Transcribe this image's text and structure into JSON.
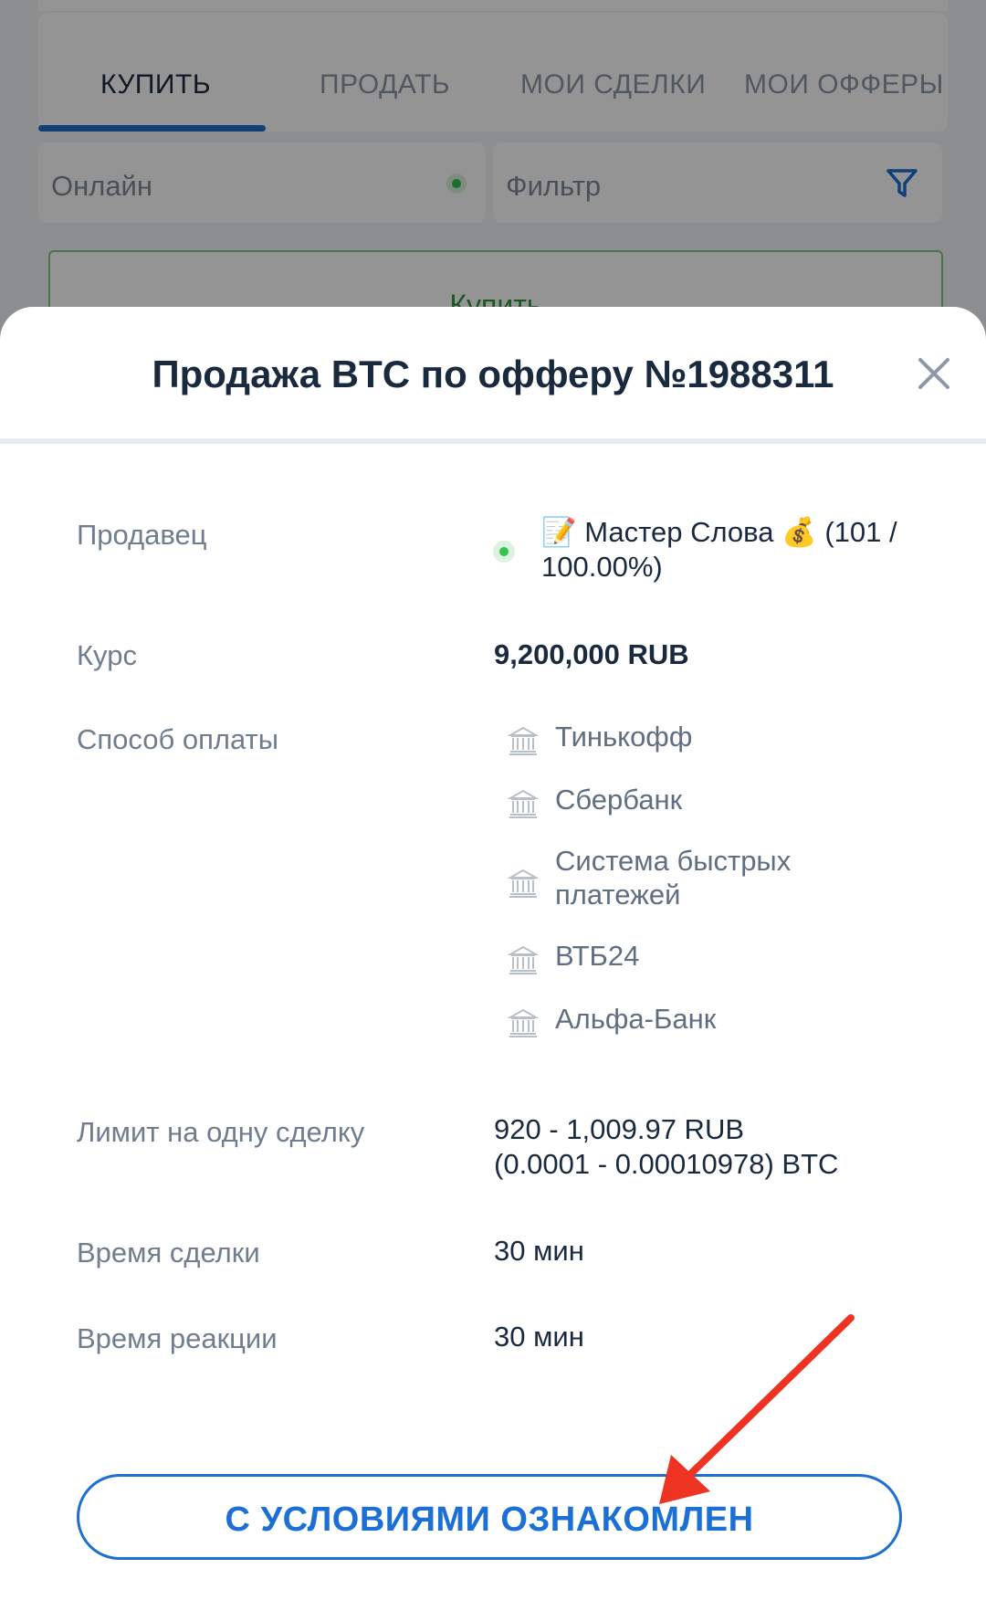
{
  "background": {
    "tabs": [
      {
        "label": "КУПИТЬ",
        "active": true
      },
      {
        "label": "ПРОДАТЬ",
        "active": false
      },
      {
        "label": "МОИ СДЕЛКИ",
        "active": false
      },
      {
        "label": "МОИ ОФФЕРЫ",
        "active": false
      }
    ],
    "online_filter": "Онлайн",
    "filter_label": "Фильтр",
    "buy_button": "Купить"
  },
  "modal": {
    "title": "Продажа BTC по офферу №1988311",
    "close_icon": "close-icon",
    "seller": {
      "label": "Продавец",
      "value": "📝 Мастер Слова 💰 (101 / 100.00%)",
      "status": "online"
    },
    "rate": {
      "label": "Курс",
      "value": "9,200,000 RUB"
    },
    "payment": {
      "label": "Способ оплаты",
      "methods": [
        "Тинькофф",
        "Сбербанк",
        "Система быстрых платежей",
        "ВТБ24",
        "Альфа-Банк"
      ]
    },
    "limit": {
      "label": "Лимит на одну сделку",
      "value_line1": "920 - 1,009.97 RUB",
      "value_line2": "(0.0001 - 0.00010978) BTC"
    },
    "deal_time": {
      "label": "Время сделки",
      "value": "30 мин"
    },
    "reaction_time": {
      "label": "Время реакции",
      "value": "30 мин"
    },
    "accept_button": "С УСЛОВИЯМИ ОЗНАКОМЛЕН"
  },
  "colors": {
    "accent": "#1c6fd4",
    "text_dark": "#1a2a3e",
    "text_muted": "#6f7d8e",
    "online": "#39c251",
    "annotation_arrow": "#ee3322"
  }
}
